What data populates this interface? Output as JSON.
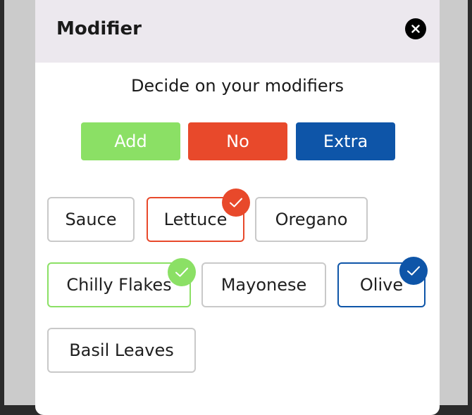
{
  "modal": {
    "title": "Modifier",
    "subtitle": "Decide on your modifiers"
  },
  "modes": [
    {
      "label": "Add",
      "color": "#8be065"
    },
    {
      "label": "No",
      "color": "#e8492b"
    },
    {
      "label": "Extra",
      "color": "#0e55a8"
    }
  ],
  "modifiers": [
    {
      "label": "Sauce",
      "selected": null
    },
    {
      "label": "Lettuce",
      "selected": "No"
    },
    {
      "label": "Oregano",
      "selected": null
    },
    {
      "label": "Chilly Flakes",
      "selected": "Add"
    },
    {
      "label": "Mayonese",
      "selected": null
    },
    {
      "label": "Olive",
      "selected": "Extra"
    },
    {
      "label": "Basil Leaves",
      "selected": null
    }
  ],
  "icons": {
    "close": "close-icon",
    "check": "check-icon"
  },
  "colors": {
    "header_bg": "#ece8ee",
    "backdrop": "#cbcbcb",
    "chip_border": "#c9c9c9"
  }
}
